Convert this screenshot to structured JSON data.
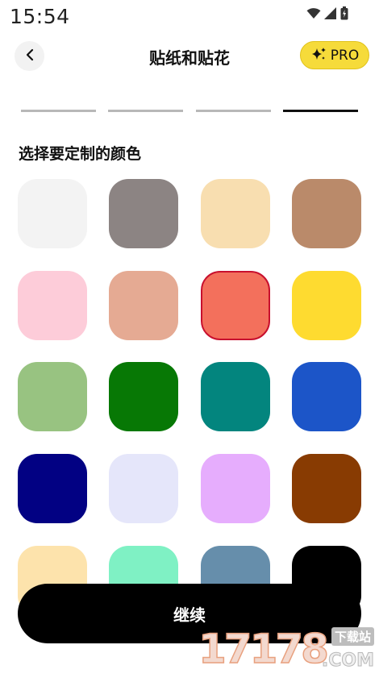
{
  "status_bar": {
    "time": "15:54",
    "icons": [
      "wifi-icon",
      "signal-icon",
      "battery-charging-icon"
    ]
  },
  "header": {
    "back_icon": "chevron-left-icon",
    "title": "贴纸和贴花",
    "pro_label": "PRO",
    "pro_icon": "sparkle-icon",
    "pro_color": "#f6db3a"
  },
  "progress": {
    "total_steps": 4,
    "current_step": 4
  },
  "section_title": "选择要定制的颜色",
  "swatches": [
    {
      "color": "#f3f3f3",
      "selected": false
    },
    {
      "color": "#8c8483",
      "selected": false
    },
    {
      "color": "#f8deb0",
      "selected": false
    },
    {
      "color": "#ba8a6a",
      "selected": false
    },
    {
      "color": "#fdccd9",
      "selected": false
    },
    {
      "color": "#e5aa93",
      "selected": false
    },
    {
      "color": "#f3705c",
      "selected": true
    },
    {
      "color": "#fedb30",
      "selected": false
    },
    {
      "color": "#98c381",
      "selected": false
    },
    {
      "color": "#077805",
      "selected": false
    },
    {
      "color": "#03857e",
      "selected": false
    },
    {
      "color": "#1c55c8",
      "selected": false
    },
    {
      "color": "#020183",
      "selected": false
    },
    {
      "color": "#e5e6fa",
      "selected": false
    },
    {
      "color": "#e6adfd",
      "selected": false
    },
    {
      "color": "#883b02",
      "selected": false
    },
    {
      "color": "#fde3ac",
      "selected": false
    },
    {
      "color": "#7ff1c4",
      "selected": false
    },
    {
      "color": "#668eab",
      "selected": false
    },
    {
      "color": "#000000",
      "selected": false
    }
  ],
  "continue_label": "继续",
  "watermark": {
    "digits": "17178",
    "site_label": "下载站",
    "domain": ".COM"
  }
}
